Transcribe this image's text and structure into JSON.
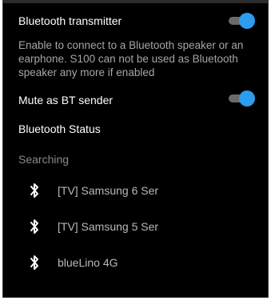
{
  "settings": {
    "bt_transmitter": {
      "label": "Bluetooth transmitter",
      "description": "Enable to connect to a Bluetooth speaker or an earphone. S100 can not be used as Bluetooth speaker any more if enabled",
      "enabled": true
    },
    "mute_bt_sender": {
      "label": "Mute as BT sender",
      "enabled": true
    },
    "bt_status": {
      "label": "Bluetooth Status"
    }
  },
  "devices_section": {
    "header": "Searching",
    "items": [
      {
        "name": "[TV] Samsung 6 Ser",
        "icon": "bluetooth-icon"
      },
      {
        "name": "[TV] Samsung 5 Ser",
        "icon": "bluetooth-icon"
      },
      {
        "name": "blueLino 4G",
        "icon": "bluetooth-icon"
      }
    ]
  },
  "colors": {
    "background": "#000000",
    "accent": "#2d9cf0",
    "track": "#6a6a6a",
    "secondary_text": "#a6a6a6"
  }
}
